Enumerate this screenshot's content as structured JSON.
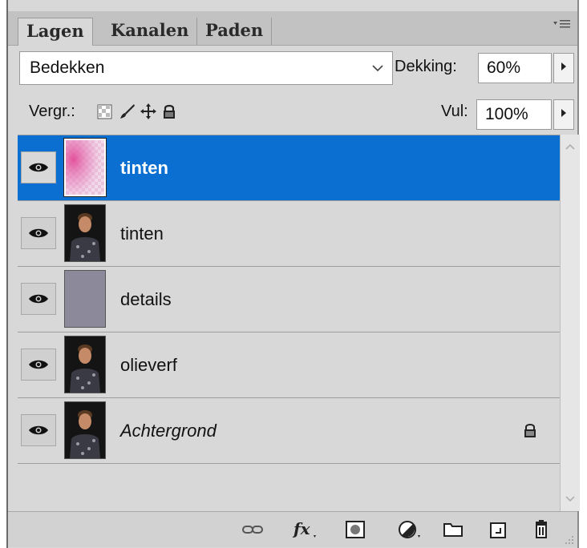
{
  "panel": {
    "tabs": [
      {
        "label": "Lagen",
        "active": true
      },
      {
        "label": "Kanalen",
        "active": false
      },
      {
        "label": "Paden",
        "active": false
      }
    ],
    "menu_icon": "panel-menu-icon"
  },
  "blend": {
    "mode": "Bedekken",
    "opacity_label": "Dekking:",
    "opacity_value": "60%"
  },
  "locks": {
    "label": "Vergr.:",
    "icons": [
      "lock-transparency-icon",
      "lock-pixels-icon",
      "lock-position-icon",
      "lock-all-icon"
    ],
    "fill_label": "Vul:",
    "fill_value": "100%"
  },
  "layers": [
    {
      "name": "tinten",
      "selected": true,
      "italic": false,
      "thumb": "pink-checker",
      "locked": false
    },
    {
      "name": "tinten",
      "selected": false,
      "italic": false,
      "thumb": "portrait",
      "locked": false
    },
    {
      "name": "details",
      "selected": false,
      "italic": false,
      "thumb": "gray",
      "locked": false
    },
    {
      "name": "olieverf",
      "selected": false,
      "italic": false,
      "thumb": "portrait",
      "locked": false
    },
    {
      "name": "Achtergrond",
      "selected": false,
      "italic": true,
      "thumb": "portrait",
      "locked": true
    }
  ],
  "bottom_icons": [
    "link-layers-icon",
    "fx-icon",
    "layer-mask-icon",
    "adjustment-layer-icon",
    "new-group-icon",
    "new-layer-icon",
    "trash-icon"
  ],
  "colors": {
    "selected_row": "#0a6fd0",
    "panel_bg": "#d8d8d8",
    "tab_bar": "#c2c2c2"
  }
}
